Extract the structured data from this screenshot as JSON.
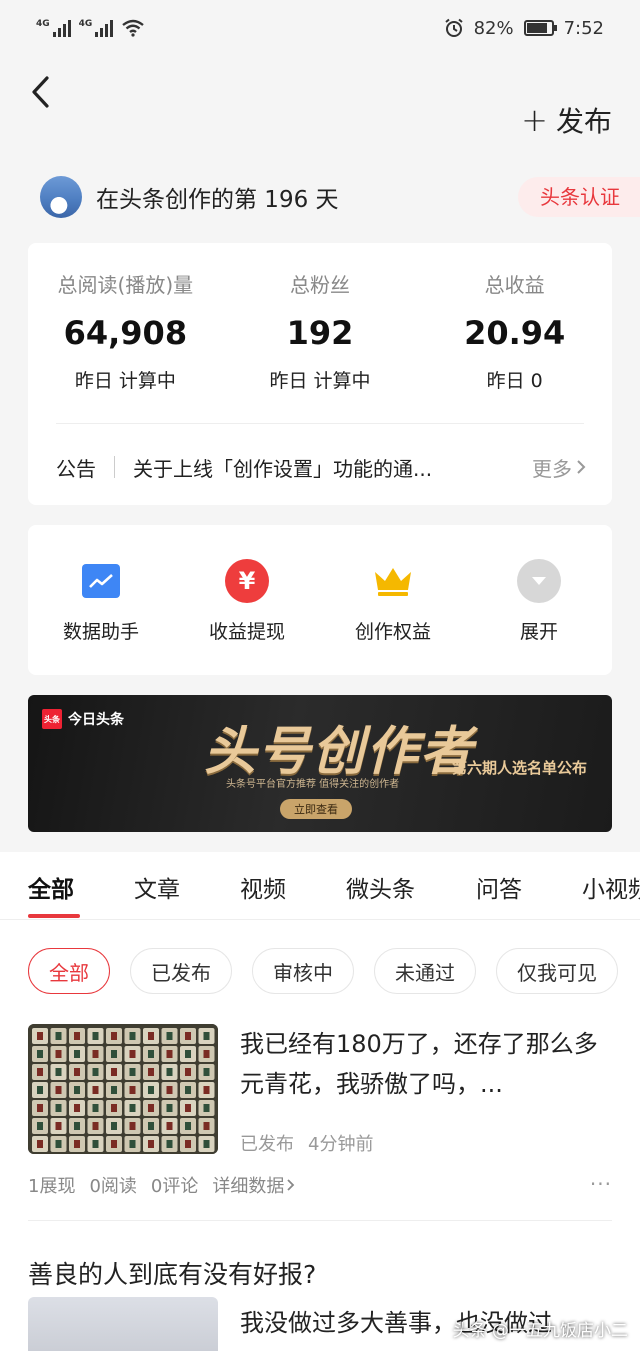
{
  "status_bar": {
    "signal1_label": "4G",
    "signal2_label": "4G",
    "wifi_icon": "wifi-icon",
    "alarm_icon": "alarm-icon",
    "battery_percent": "82%",
    "battery_level": 0.82,
    "time": "7:52"
  },
  "header": {
    "back_icon": "chevron-left-icon",
    "publish_plus": "+",
    "publish_label": "发布"
  },
  "creator": {
    "text": "在头条创作的第 196 天",
    "badge": "头条认证"
  },
  "stats": [
    {
      "label": "总阅读(播放)量",
      "value": "64,908",
      "sub": "昨日 计算中"
    },
    {
      "label": "总粉丝",
      "value": "192",
      "sub": "昨日 计算中"
    },
    {
      "label": "总收益",
      "value": "20.94",
      "sub": "昨日 0"
    }
  ],
  "notice": {
    "label": "公告",
    "text": "关于上线「创作设置」功能的通...",
    "more": "更多"
  },
  "tools": [
    {
      "label": "数据助手",
      "icon": "chart-icon",
      "color": "#3e86f5"
    },
    {
      "label": "收益提现",
      "icon": "yuan-icon",
      "symbol": "¥",
      "color": "#ee3d3d"
    },
    {
      "label": "创作权益",
      "icon": "crown-icon",
      "color": "#f5b800"
    },
    {
      "label": "展开",
      "icon": "expand-icon",
      "color": "#d7d7d7"
    }
  ],
  "banner": {
    "brand_logo": "头条",
    "brand": "今日头条",
    "headline": "头号创作者",
    "subtitle": "头条号平台官方推荐 值得关注的创作者",
    "right_note": "第六期人选名单公布",
    "cta": "立即查看"
  },
  "tabs": [
    "全部",
    "文章",
    "视频",
    "微头条",
    "问答",
    "小视频"
  ],
  "active_tab": "全部",
  "filters": [
    "全部",
    "已发布",
    "审核中",
    "未通过",
    "仅我可见"
  ],
  "active_filter": "全部",
  "article1": {
    "title": "我已经有180万了，还存了那么多元青花，我骄傲了吗，...",
    "status": "已发布",
    "time": "4分钟前",
    "impressions": "1展现",
    "reads": "0阅读",
    "comments": "0评论",
    "detail": "详细数据",
    "more": "···"
  },
  "article2": {
    "title": "善良的人到底有没有好报?",
    "text": "我没做过多大善事，也没做过"
  },
  "watermark": "头条 @一五九饭店小二"
}
